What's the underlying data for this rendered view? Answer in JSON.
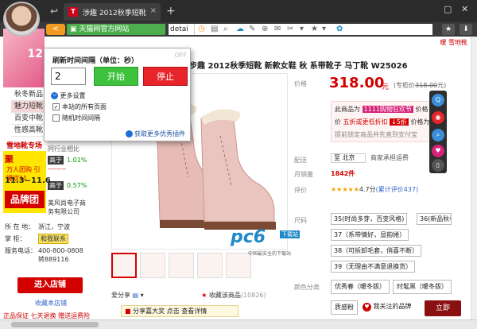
{
  "browser": {
    "tab_title": "涉趣 2012秋季短靴",
    "tab_favicon": "T",
    "tab_close": "×",
    "new_tab": "+",
    "win_min": "▢",
    "win_close": "✕",
    "secure_label": "天猫网官方网站",
    "address_text": "detai",
    "brand_color": "#d0021b",
    "secure_color": "#4cae4c"
  },
  "page": {
    "top_right_link": "暖 雪地靴",
    "product_title": "步趣 2012秋季短靴 新款女鞋 秋 系带靴子 马丁靴 W25026",
    "left_menu": [
      {
        "label": "秋冬新品",
        "on": false
      },
      {
        "label": "魅力短靴",
        "on": true
      },
      {
        "label": "百变中靴",
        "on": false
      },
      {
        "label": "性感高靴",
        "on": false
      }
    ],
    "banner_num": "12",
    "shop_title": "雪地靴专场",
    "same_industry": "同行业相比",
    "stats": [
      {
        "tag": "高于",
        "val": "1.01%"
      },
      {
        "tag": "高于",
        "val": "0.57%"
      }
    ],
    "promo": {
      "l1": "聚",
      "l2": "万人团购 引爆双11",
      "l3": "11.3~11.6",
      "l4": "品牌团"
    },
    "shop_company": "务有限公司",
    "shop_company_prefix": "美风尚电子商",
    "location_label": "所 在 地：",
    "location_value": "浙江，宁波",
    "wangwang_label": "掌    柜：",
    "contact_btn": "和我联系",
    "service_label": "服务电话：",
    "service_value": "400-800-0808",
    "service_ext": "转889116",
    "enter_shop": "进入店铺",
    "fav_shop": "收藏本店铺",
    "bottom_strip": "正品保证 七天退换 赠送运费险",
    "share_label": "爱分享",
    "fav_count_label": "收藏该商品",
    "fav_count": "(10826)",
    "share_bar_text": "分享嘉大奖 点击 查看详情",
    "watermark": {
      "big": "pc6",
      "badge": "下载站",
      "sub": "中国最安全的下载站"
    },
    "price_label": "价格",
    "price": "318.00",
    "price_yuan": "元",
    "orig_price_label": "(专柜价",
    "orig_price": "318.00",
    "orig_price_tail": "元)",
    "promo_lines": {
      "l1a": "此商品为",
      "l1tag": "1111购物狂欢节",
      "l1b": "价格",
      "l2a": "价",
      "l2red": "五折或更低折扣",
      "l2tag": "↓5折",
      "l2b": "价格为",
      "l3": "提前锁定商品并先直到支付宝"
    },
    "ship_label": "配送",
    "ship_value": "至 北京",
    "ship_note": "商家承担运费",
    "sales_label": "月销量",
    "sales_value": "1842件",
    "rating_label": "评价",
    "stars": "★★★★★",
    "rating_score": "4.7分",
    "rating_link": "(累计评价437)",
    "size_label": "尺码",
    "sizes": [
      "35(时尚多芽，百变风格)",
      "36(新品秋季, 5",
      "37（系带情好，显韵绻）",
      "38（可拆卸毛套，俏喜不断）",
      "39（无理由不满意退换货）"
    ],
    "color_label": "颜色分类",
    "colors": [
      "优秀春（暖冬版）",
      "时髦黑（暖冬版）",
      "质感粉"
    ],
    "brand_fav": "我关注的品牌",
    "add_cart": "立即"
  },
  "popup": {
    "off_label": "OFF",
    "title": "刷新时间间隔（单位：秒）",
    "interval_value": "2",
    "start_label": "开始",
    "stop_label": "停止",
    "more_settings": "更多设置",
    "opt_all_pages": "本站的所有页面",
    "opt_random": "随机时间间隔",
    "get_plugins": "获取更多优秀插件",
    "start_color": "#3ec23e",
    "stop_color": "#e8242b"
  }
}
